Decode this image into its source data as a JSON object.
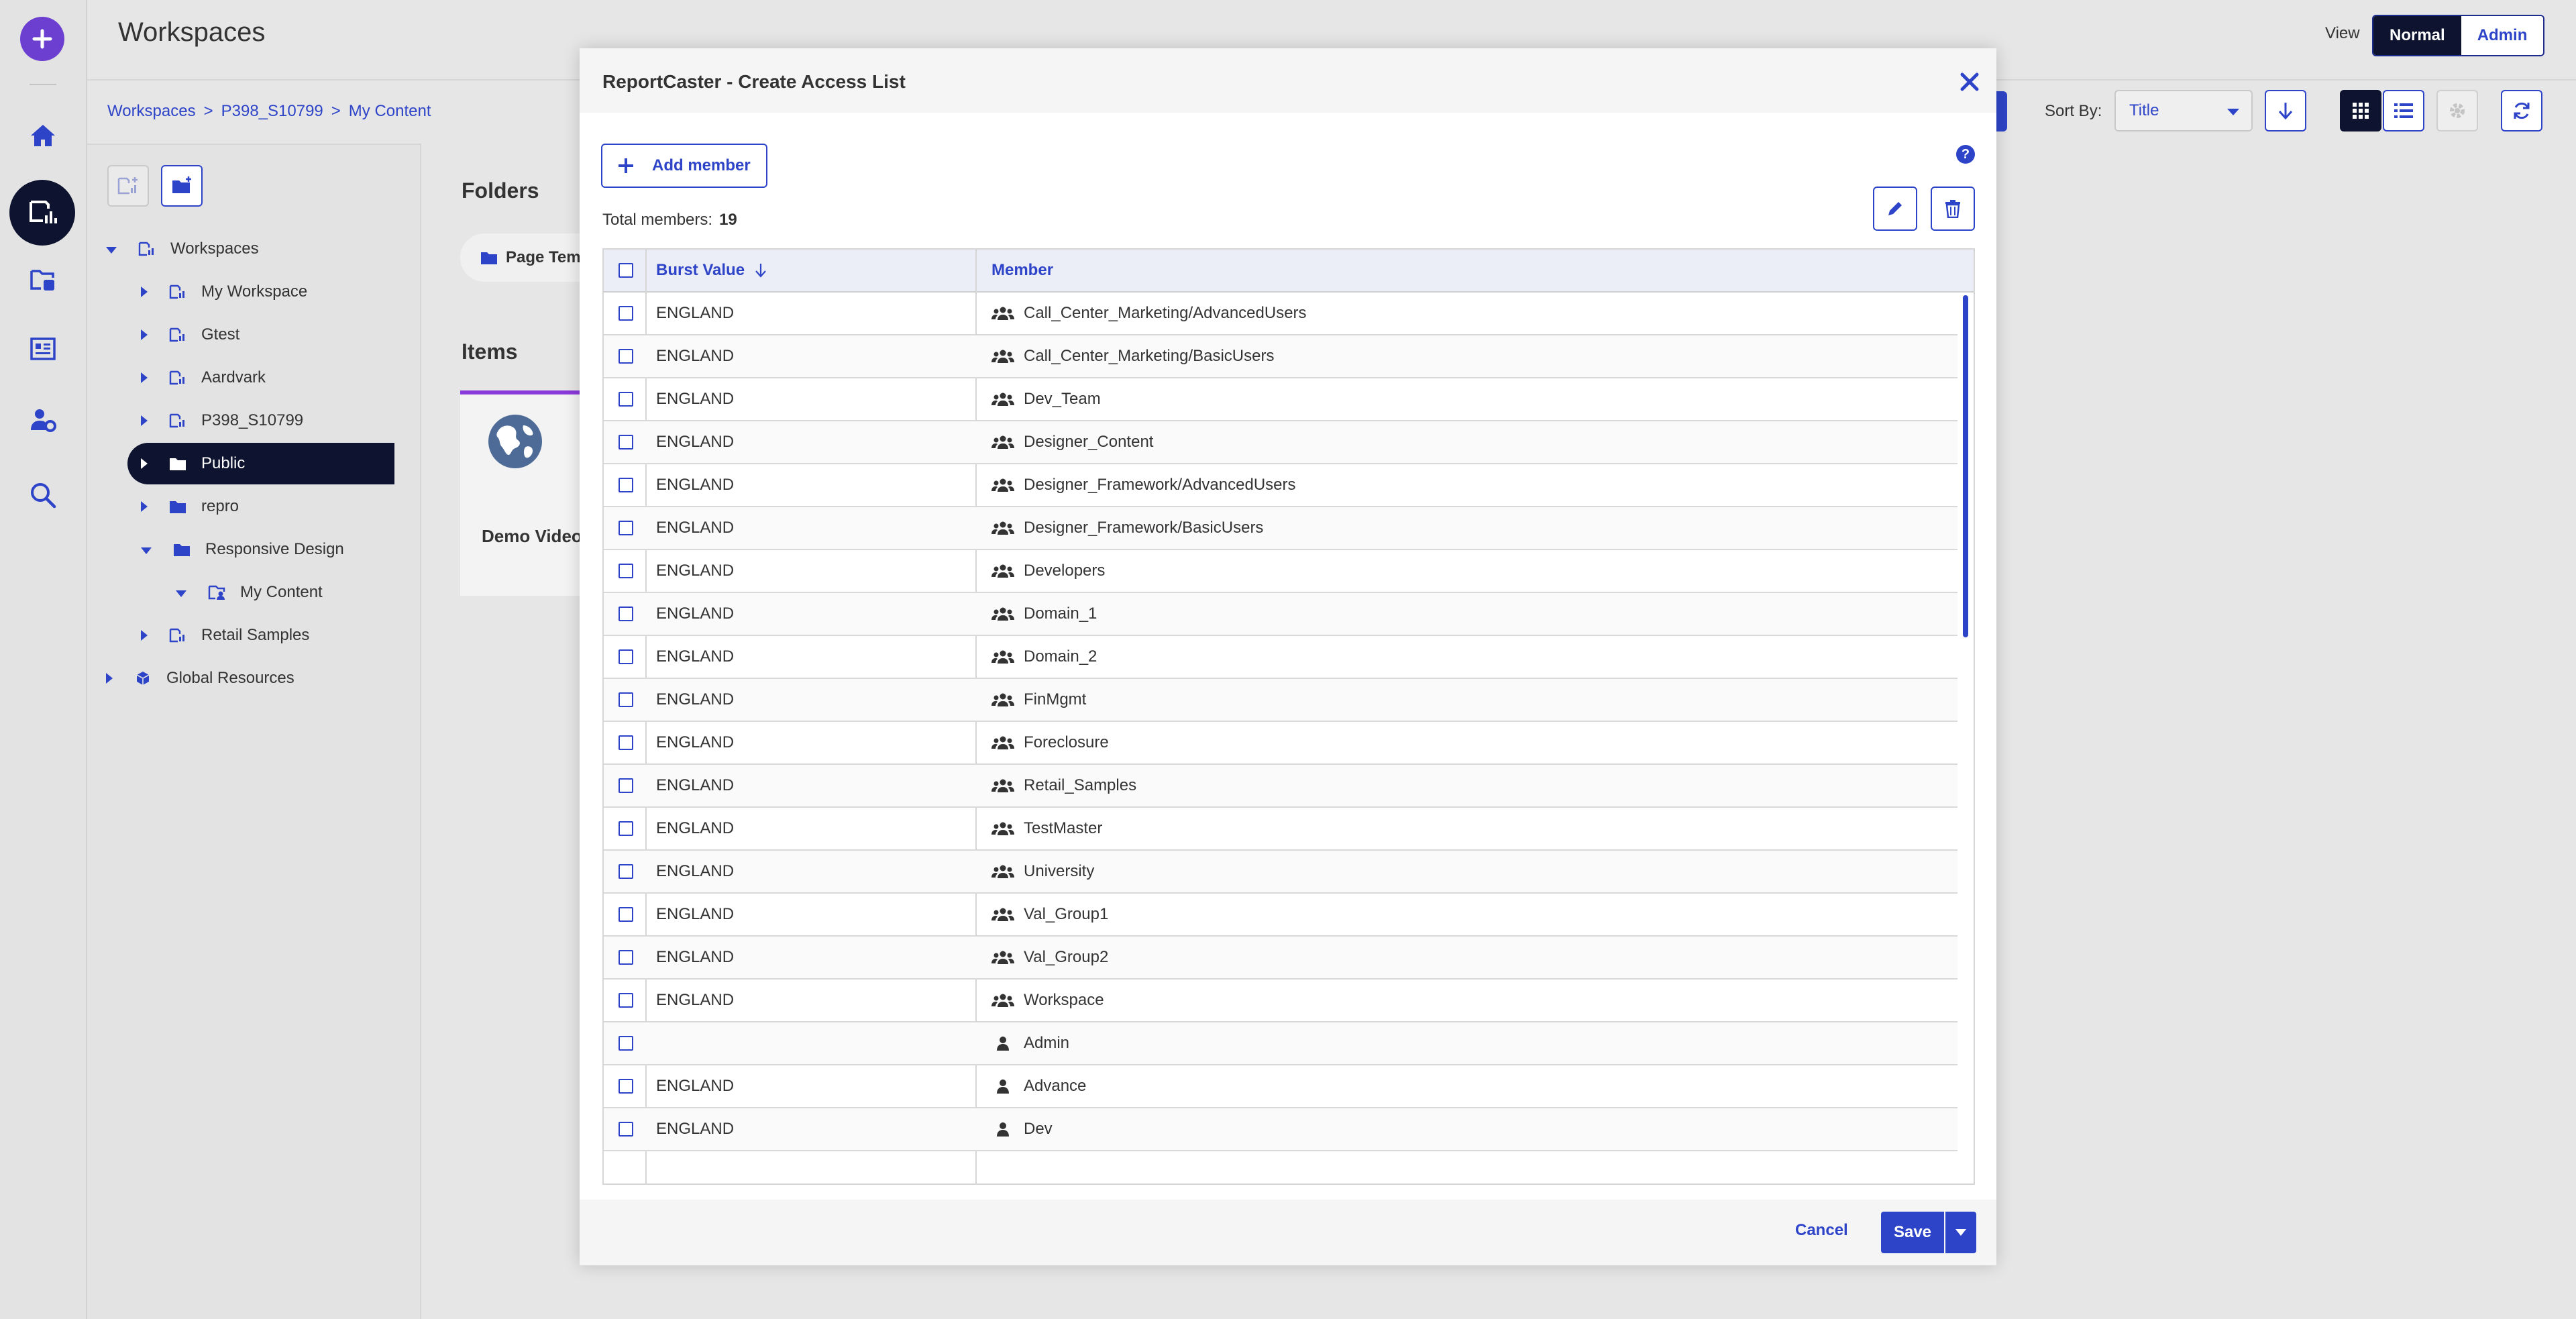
{
  "app": {
    "title": "Workspaces",
    "view_label": "View",
    "view_options": [
      "Normal",
      "Admin"
    ],
    "breadcrumb": [
      "Workspaces",
      "P398_S10799",
      "My Content"
    ],
    "sort_label": "Sort By:",
    "sort_value": "Title"
  },
  "tree": [
    {
      "label": "Workspaces",
      "level": 0,
      "expanded": true,
      "icon": "workspace-icon"
    },
    {
      "label": "My Workspace",
      "level": 1,
      "expanded": false,
      "icon": "workspace-icon"
    },
    {
      "label": "Gtest",
      "level": 1,
      "expanded": false,
      "icon": "workspace-icon"
    },
    {
      "label": "Aardvark",
      "level": 1,
      "expanded": false,
      "icon": "workspace-icon"
    },
    {
      "label": "P398_S10799",
      "level": 1,
      "expanded": false,
      "icon": "workspace-icon"
    },
    {
      "label": "Public",
      "level": 1,
      "expanded": false,
      "icon": "folder-icon",
      "selected": true
    },
    {
      "label": "repro",
      "level": 1,
      "expanded": false,
      "icon": "folder-icon"
    },
    {
      "label": "Responsive Design",
      "level": 1,
      "expanded": true,
      "icon": "folder-icon"
    },
    {
      "label": "My Content",
      "level": 2,
      "expanded": true,
      "icon": "my-content-icon"
    },
    {
      "label": "Retail Samples",
      "level": 1,
      "expanded": false,
      "icon": "workspace-icon"
    },
    {
      "label": "Global Resources",
      "level": 0,
      "expanded": false,
      "icon": "global-resources-icon"
    }
  ],
  "content": {
    "folders_title": "Folders",
    "folder_chip": "Page Temp",
    "items_title": "Items",
    "item_card": "Demo Video"
  },
  "dialog": {
    "title": "ReportCaster - Create Access List",
    "add_member": "Add member",
    "help": "?",
    "total_label": "Total members:",
    "total_count": "19",
    "columns": [
      "Burst Value",
      "Member"
    ],
    "rows": [
      {
        "burst": "ENGLAND",
        "member": "Call_Center_Marketing/AdvancedUsers",
        "type": "group"
      },
      {
        "burst": "ENGLAND",
        "member": "Call_Center_Marketing/BasicUsers",
        "type": "group"
      },
      {
        "burst": "ENGLAND",
        "member": "Dev_Team",
        "type": "group"
      },
      {
        "burst": "ENGLAND",
        "member": "Designer_Content",
        "type": "group"
      },
      {
        "burst": "ENGLAND",
        "member": "Designer_Framework/AdvancedUsers",
        "type": "group"
      },
      {
        "burst": "ENGLAND",
        "member": "Designer_Framework/BasicUsers",
        "type": "group"
      },
      {
        "burst": "ENGLAND",
        "member": "Developers",
        "type": "group"
      },
      {
        "burst": "ENGLAND",
        "member": "Domain_1",
        "type": "group"
      },
      {
        "burst": "ENGLAND",
        "member": "Domain_2",
        "type": "group"
      },
      {
        "burst": "ENGLAND",
        "member": "FinMgmt",
        "type": "group"
      },
      {
        "burst": "ENGLAND",
        "member": "Foreclosure",
        "type": "group"
      },
      {
        "burst": "ENGLAND",
        "member": "Retail_Samples",
        "type": "group"
      },
      {
        "burst": "ENGLAND",
        "member": "TestMaster",
        "type": "group"
      },
      {
        "burst": "ENGLAND",
        "member": "University",
        "type": "group"
      },
      {
        "burst": "ENGLAND",
        "member": "Val_Group1",
        "type": "group"
      },
      {
        "burst": "ENGLAND",
        "member": "Val_Group2",
        "type": "group"
      },
      {
        "burst": "ENGLAND",
        "member": "Workspace",
        "type": "group"
      },
      {
        "burst": "",
        "member": "Admin",
        "type": "user"
      },
      {
        "burst": "ENGLAND",
        "member": "Advance",
        "type": "user"
      },
      {
        "burst": "ENGLAND",
        "member": "Dev",
        "type": "user"
      }
    ],
    "cancel": "Cancel",
    "save": "Save"
  },
  "colors": {
    "accent": "#2e44c8",
    "dark": "#0e1330",
    "purple": "#6c3fd1"
  }
}
